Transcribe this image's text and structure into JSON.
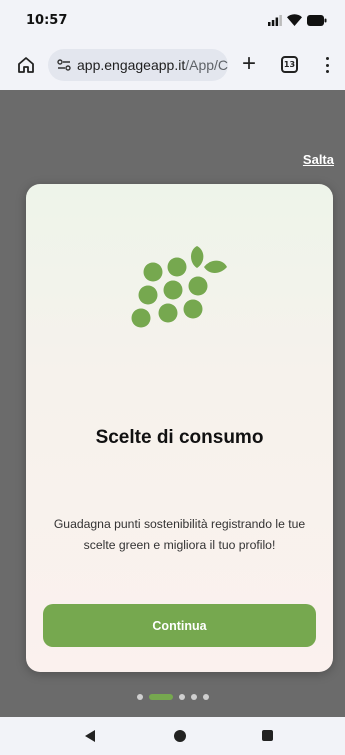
{
  "status_bar": {
    "time": "10:57",
    "icons": [
      "signal-icon",
      "wifi-icon",
      "battery-icon"
    ]
  },
  "browser": {
    "url_domain": "app.engageapp.it",
    "url_path": "/App/C",
    "tab_count": "13",
    "icons": [
      "home-icon",
      "site-settings-icon",
      "plus-icon",
      "tabs-icon",
      "more-menu-icon"
    ]
  },
  "onboarding": {
    "skip_label": "Salta",
    "icon": "grapes-icon",
    "title": "Scelte di consumo",
    "description": "Guadagna punti sostenibilità registrando le tue scelte green e migliora il tuo profilo!",
    "continue_label": "Continua",
    "pagination": {
      "total": 5,
      "active_index": 1
    }
  },
  "colors": {
    "accent": "#76a84f",
    "overlay": "#6b6b6b",
    "chrome": "#f2f3f8"
  },
  "nav_bar": {
    "icons": [
      "back-icon",
      "home-circle-icon",
      "recents-icon"
    ]
  }
}
